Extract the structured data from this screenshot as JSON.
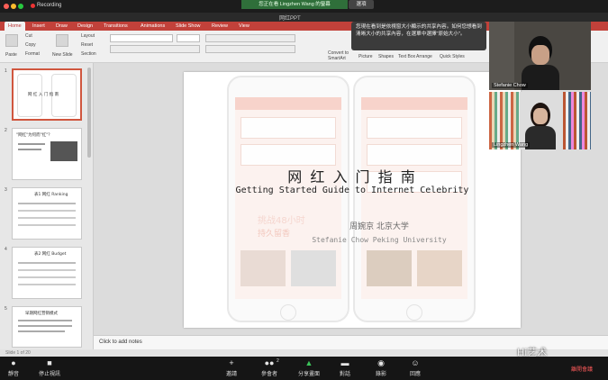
{
  "topbar": {
    "recording_label": "Recording",
    "share_banner": "您正在看 Lingzhen Wang 的螢幕",
    "view_button": "選項"
  },
  "app": {
    "doc_title": "网红PPT",
    "tabs": [
      "Home",
      "Insert",
      "Draw",
      "Design",
      "Transitions",
      "Animations",
      "Slide Show",
      "Review",
      "View"
    ],
    "ribbon": {
      "paste": "Paste",
      "cut": "Cut",
      "copy": "Copy",
      "format": "Format",
      "new_slide": "New Slide",
      "layout": "Layout",
      "reset": "Reset",
      "section": "Section",
      "convert": "Convert to SmartArt",
      "picture": "Picture",
      "shapes": "Shapes",
      "textbox": "Text Box",
      "arrange": "Arrange",
      "quick_styles": "Quick Styles"
    },
    "popup_text": "您現在看到是依視窗大小顯示的共享內容。如何您想看到清晰大小的共享內容，在選單中選擇\"原始大小\"。"
  },
  "thumbnails": [
    {
      "num": "1",
      "title": "网 红 入 门 指 南"
    },
    {
      "num": "2",
      "title": "\"网红\"为何而\"红\"？"
    },
    {
      "num": "3",
      "title": "表1 网红 Ranking"
    },
    {
      "num": "4",
      "title": "表2 网红 Budget"
    },
    {
      "num": "5",
      "title": "早期网红营销模式"
    }
  ],
  "slide": {
    "title_cn": "网 红 入 门 指 南",
    "title_en": "Getting Started Guide to Internet Celebrity",
    "author_cn": "周婉京  北京大学",
    "author_en": "Stefanie Chow  Peking University",
    "bg_text": "挑战48小时",
    "bg_text2": "持久留香"
  },
  "notes": "Click to add notes",
  "status": "Slide 1 of 20",
  "participants": [
    {
      "name": "Stefanie Chow"
    },
    {
      "name": "Lingzhen Wang"
    }
  ],
  "toolbar": {
    "items": [
      "靜音",
      "停止視訊",
      "邀請",
      "參會者",
      "分享畫面",
      "對話",
      "錄影",
      "回應"
    ],
    "participant_count": "2",
    "end": "離開會議"
  },
  "watermark": "Hi艺术",
  "colors": {
    "accent": "#c2413a",
    "share_green": "#2f6f3a"
  }
}
